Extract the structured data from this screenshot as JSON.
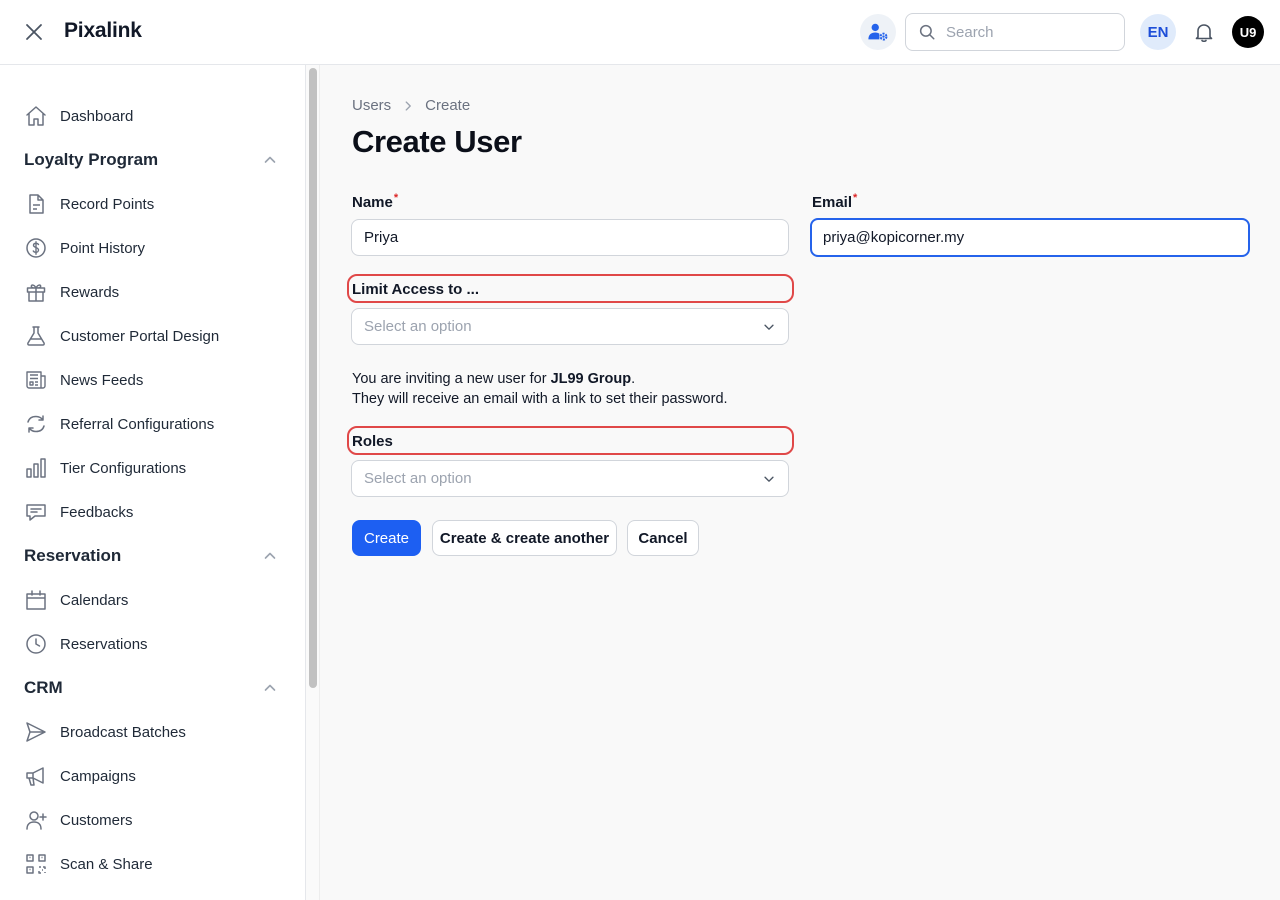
{
  "header": {
    "app_name": "Pixalink",
    "search_placeholder": "Search",
    "language": "EN",
    "user_initials": "U9"
  },
  "sidebar": {
    "dashboard": "Dashboard",
    "groups": [
      {
        "label": "Loyalty Program",
        "items": [
          "Record Points",
          "Point History",
          "Rewards",
          "Customer Portal Design",
          "News Feeds",
          "Referral Configurations",
          "Tier Configurations",
          "Feedbacks"
        ]
      },
      {
        "label": "Reservation",
        "items": [
          "Calendars",
          "Reservations"
        ]
      },
      {
        "label": "CRM",
        "items": [
          "Broadcast Batches",
          "Campaigns",
          "Customers",
          "Scan & Share"
        ]
      }
    ]
  },
  "main": {
    "breadcrumbs": [
      "Users",
      "Create"
    ],
    "title": "Create User",
    "form": {
      "name_label": "Name",
      "name_value": "Priya",
      "email_label": "Email",
      "email_value": "priya@kopicorner.my",
      "required_mark": "*",
      "limit_label": "Limit Access to ...",
      "limit_placeholder": "Select an option",
      "invite_text_1": "You are inviting a new user for ",
      "invite_org": "JL99 Group",
      "invite_text_2": ".",
      "invite_text_3": "They will receive an email with a link to set their password.",
      "roles_label": "Roles",
      "roles_placeholder": "Select an option"
    },
    "buttons": {
      "create": "Create",
      "create_another": "Create & create another",
      "cancel": "Cancel"
    }
  },
  "colors": {
    "primary": "#1d5ff2",
    "focus_border": "#2563eb",
    "highlight_border": "#e04848",
    "required": "#dc2626"
  }
}
